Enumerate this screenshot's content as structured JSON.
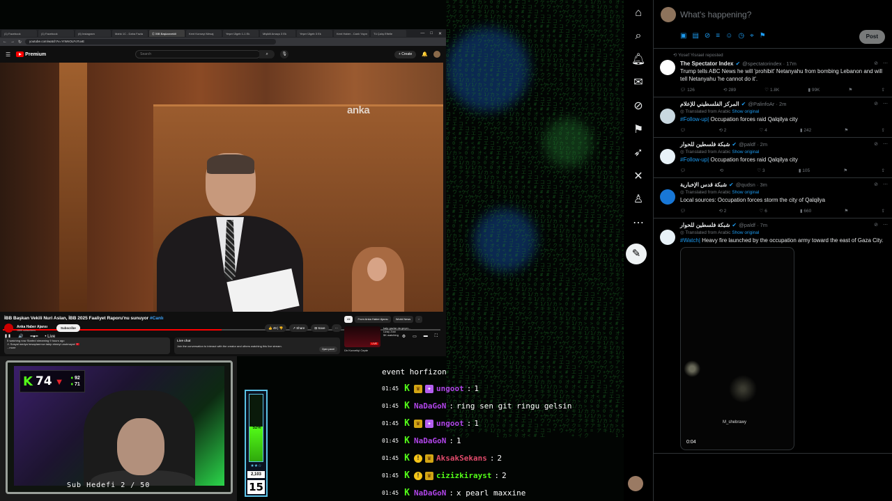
{
  "browser": {
    "tabs": [
      "(1) Facebook",
      "(1) Facebook",
      "(6) Instagram",
      "Mahk 1C - Daha Fazla",
      "Ⓒ İBB Başkanvekili",
      "Kent Konseyi Mesaj",
      "Yeşer Ülgeb 1-1 Ek",
      "Mişiklli Amaçs 3 Ek",
      "Yeşer Ülgeb 3 Ek",
      "Kent Haber - Canlı Yayın",
      "Tü Çalış Eftelle"
    ],
    "url": "youtube.com/watch?v=YrWnOLFoTuvE",
    "nav_symbols": [
      "←",
      "→",
      "↻"
    ],
    "window_controls": [
      "—",
      "□",
      "✕"
    ]
  },
  "youtube": {
    "logo_text": "Premium",
    "search_placeholder": "Search",
    "create_label": "+ Create",
    "watermark": "anka",
    "live_label": "• Live",
    "title": "İBB Başkan Vekili Nuri Aslan, İBB 2025 Faaliyet Raporu'nu sunuyor",
    "title_tag": "#Canlı",
    "channel_name": "Anka Haber Ajansı",
    "channel_subs": "166K subscribers",
    "subscribe_label": "Subscribe",
    "likes": "49",
    "share_label": "Share",
    "save_label": "Save",
    "description": "5 watching now  Started streaming 9 hours ago\n⚠ Sosyal medya hesaplarımızı takip etmeyi unutmayın! 🇹🇷\n...more",
    "live_chat_title": "Live chat",
    "live_chat_text": "Join the conversation to interact with the creator and others watching this live stream.",
    "open_panel_label": "Open panel",
    "chips": [
      "All",
      "From Anka Haber Ajansı",
      "World News"
    ],
    "related_title": "kalp gazlar da geçer...",
    "related_channel": "Uzay Zoki",
    "related_meta": "5K watching",
    "related_live": "LIVE",
    "related_next": "Ün Kuvvetiçi Cepte"
  },
  "webcam": {
    "k_score": "74",
    "stat_top": "92",
    "stat_bottom": "71",
    "sub_goal": "Sub Hedefi 2 / 50"
  },
  "meter": {
    "percent_value": 52,
    "percent_label": "52%",
    "stars": "★★☆",
    "count": "2,103",
    "big": "15"
  },
  "kick_chat": {
    "header": "event horfizon",
    "messages": [
      {
        "time": "01:45",
        "badges": [
          "k",
          "crown",
          "gift"
        ],
        "user": "ungoot",
        "color": "#b045e8",
        "text": "1"
      },
      {
        "time": "01:45",
        "badges": [
          "k"
        ],
        "user": "NaDaGoN",
        "color": "#b045e8",
        "text": "ring sen git ringu gelsin"
      },
      {
        "time": "01:45",
        "badges": [
          "k",
          "crown",
          "gift"
        ],
        "user": "ungoot",
        "color": "#b045e8",
        "text": "1"
      },
      {
        "time": "01:45",
        "badges": [
          "k"
        ],
        "user": "NaDaGoN",
        "color": "#b045e8",
        "text": "1"
      },
      {
        "time": "01:45",
        "badges": [
          "k",
          "mod",
          "crown"
        ],
        "user": "AksakSekans",
        "color": "#e04a6a",
        "text": "2"
      },
      {
        "time": "01:45",
        "badges": [
          "k",
          "mod",
          "crown"
        ],
        "user": "cizizkirayst",
        "color": "#53fc18",
        "text": "2"
      },
      {
        "time": "01:45",
        "badges": [
          "k"
        ],
        "user": "NaDaGoN",
        "color": "#b045e8",
        "text": "x pearl maxxine"
      }
    ]
  },
  "x_nav": {
    "items": [
      "home-icon",
      "explore-icon",
      "notifications-icon",
      "messages-icon",
      "grok-icon",
      "bookmarks-icon",
      "jobs-icon",
      "x-premium-icon",
      "profile-icon",
      "more-icon"
    ]
  },
  "compose": {
    "placeholder": "What's happening?",
    "post_label": "Post"
  },
  "tweets": [
    {
      "repost": "Yosef Yisrael reposted",
      "name": "The Spectator Index",
      "handle": "@spectatorindex · 17m",
      "trans": "",
      "trans_link": "",
      "tag": "",
      "text": "Trump tells ABC News he will 'prohibit' Netanyahu from bombing Lebanon and will tell Netanyahu 'he cannot do it'.",
      "replies": "126",
      "reposts": "289",
      "likes": "1.8K",
      "views": "99K",
      "avatar_color": "#ffffff"
    },
    {
      "repost": "",
      "name": "المركز الفلسطيني للإعلام",
      "handle": "@PalinfoAr · 2m",
      "trans": "Translated from Arabic",
      "trans_link": "Show original",
      "tag": "#Follow-up|",
      "text": " Occupation forces raid Qalqilya city",
      "replies": "",
      "reposts": "2",
      "likes": "4",
      "views": "242",
      "avatar_color": "#c9d8e0"
    },
    {
      "repost": "",
      "name": "شبكة فلسطين للحوار",
      "handle": "@paldf · 2m",
      "trans": "Translated from Arabic",
      "trans_link": "Show original",
      "tag": "#Follow-up|",
      "text": " Occupation forces raid Qalqilya city",
      "replies": "",
      "reposts": "",
      "likes": "3",
      "views": "105",
      "avatar_color": "#e8f2f8"
    },
    {
      "repost": "",
      "name": "شبكة قدس الإخبارية",
      "handle": "@qudsn · 3m",
      "trans": "Translated from Arabic",
      "trans_link": "Show original",
      "tag": "",
      "text": "Local sources: Occupation forces storm the city of Qalqilya",
      "replies": "",
      "reposts": "2",
      "likes": "6",
      "views": "660",
      "avatar_color": "#1877d6"
    },
    {
      "repost": "",
      "name": "شبكة فلسطين للحوار",
      "handle": "@paldf · 7m",
      "trans": "Translated from Arabic",
      "trans_link": "Show original",
      "tag": "#Watch|",
      "text": " Heavy fire launched by the occupation army toward the east of Gaza City.",
      "replies": "",
      "reposts": "",
      "likes": "",
      "views": "",
      "avatar_color": "#e8f2f8",
      "media_watermark": "M_shebrawy",
      "media_duration": "0:04"
    }
  ]
}
